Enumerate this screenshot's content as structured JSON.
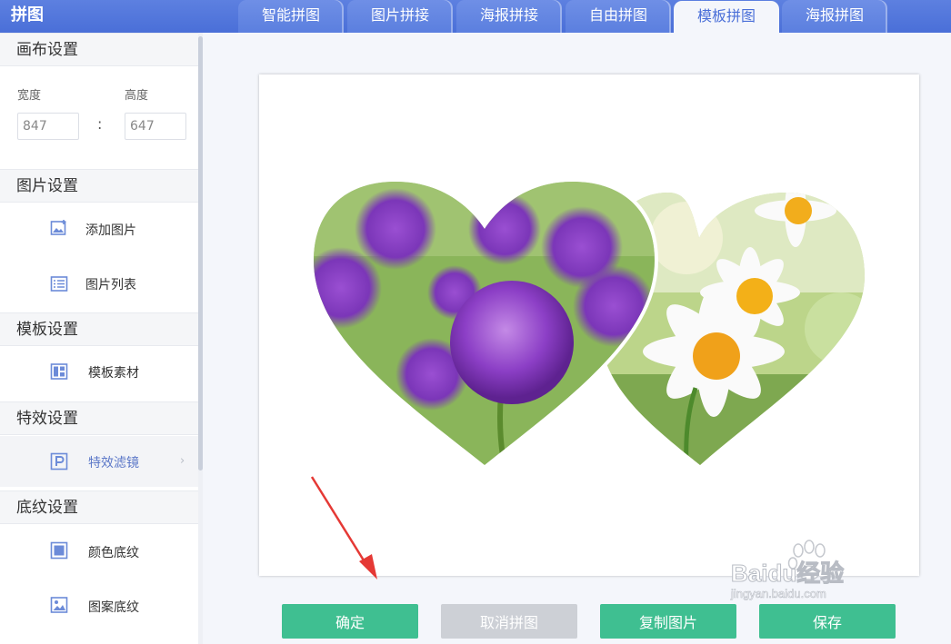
{
  "app": {
    "title": "拼图"
  },
  "tabs": [
    {
      "label": "智能拼图",
      "active": false
    },
    {
      "label": "图片拼接",
      "active": false
    },
    {
      "label": "海报拼接",
      "active": false
    },
    {
      "label": "自由拼图",
      "active": false
    },
    {
      "label": "模板拼图",
      "active": true
    },
    {
      "label": "海报拼图",
      "active": false
    }
  ],
  "sidebar": {
    "canvas_settings": {
      "title": "画布设置",
      "width_label": "宽度",
      "height_label": "高度",
      "width_value": "847",
      "height_value": "647",
      "separator": ":"
    },
    "image_settings": {
      "title": "图片设置",
      "items": [
        {
          "label": "添加图片",
          "icon": "add-image-icon"
        },
        {
          "label": "图片列表",
          "icon": "list-icon"
        }
      ]
    },
    "template_settings": {
      "title": "模板设置",
      "items": [
        {
          "label": "模板素材",
          "icon": "template-icon"
        }
      ]
    },
    "effect_settings": {
      "title": "特效设置",
      "items": [
        {
          "label": "特效滤镜",
          "icon": "filter-icon",
          "selected": true,
          "chevron": "›"
        }
      ]
    },
    "texture_settings": {
      "title": "底纹设置",
      "items": [
        {
          "label": "颜色底纹",
          "icon": "color-square-icon"
        },
        {
          "label": "图案底纹",
          "icon": "pattern-image-icon"
        }
      ]
    }
  },
  "buttons": {
    "confirm": "确定",
    "cancel": "取消拼图",
    "copy": "复制图片",
    "save": "保存"
  },
  "watermark": {
    "text_line1": "Baidu经验",
    "text_line2": "jingyan.baidu.com"
  },
  "colors": {
    "brand_blue": "#4a6fd8",
    "button_green": "#3fbf91",
    "button_gray": "#cdd0d6",
    "arrow_red": "#e53935"
  }
}
